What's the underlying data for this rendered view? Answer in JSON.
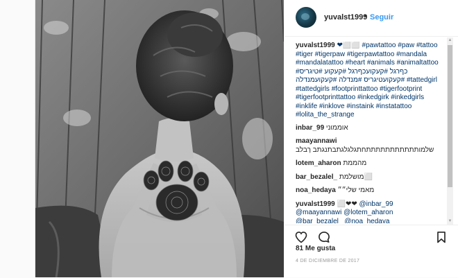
{
  "post": {
    "username": "yuvalst1999",
    "separator": "•",
    "follow_label": "Seguir",
    "caption": {
      "username": "yuvalst1999",
      "text": "❤⬜⬜ #pawtattoo #paw #tattoo #tiger #tigerpaw #tigerpawtattoo #mandala #mandalatattoo #heart #animals #animaltattoo #כףרגל #קעקועכףרגל #קעקוע #טיגריס #קעקועטיגריס #מנדלה #קעקועמנדלה #tattedgirl #tattedgirls #footprinttattoo #tigerfootprint #tigerfootprinttattoo #inkedgirk #inkedgirls #inklife #inklove #instaink #instatattoo #lolita_the_strange"
    },
    "comments": [
      {
        "user": "inbar_99",
        "text": "אוממוני"
      },
      {
        "user": "maayannawi",
        "text": "שלמותתתתתתתתתתתחתגלגלגתבתנגתב רָבלב"
      },
      {
        "user": "lotem_aharon",
        "text": "מהממת"
      },
      {
        "user": "bar_bezalel_",
        "text": "מושלמת⬜"
      },
      {
        "user": "noa_hedaya",
        "text": "מאמי שלי״״"
      }
    ],
    "reply": {
      "user": "yuvalst1999",
      "text": "⬜❤❤",
      "mentions": [
        "@inbar_99",
        "@maayannawi",
        "@lotem_aharon",
        "@bar_bezalel_",
        "@noa_hedaya"
      ]
    },
    "likes_label": "81 Me gusta",
    "date_label": "4 DE DICIEMBRE DE 2017"
  },
  "icons": {
    "heart": "heart-icon",
    "comment": "comment-icon",
    "save": "bookmark-icon"
  },
  "colors": {
    "link": "#003569",
    "follow": "#3897f0",
    "text": "#262626",
    "muted": "#999999"
  }
}
